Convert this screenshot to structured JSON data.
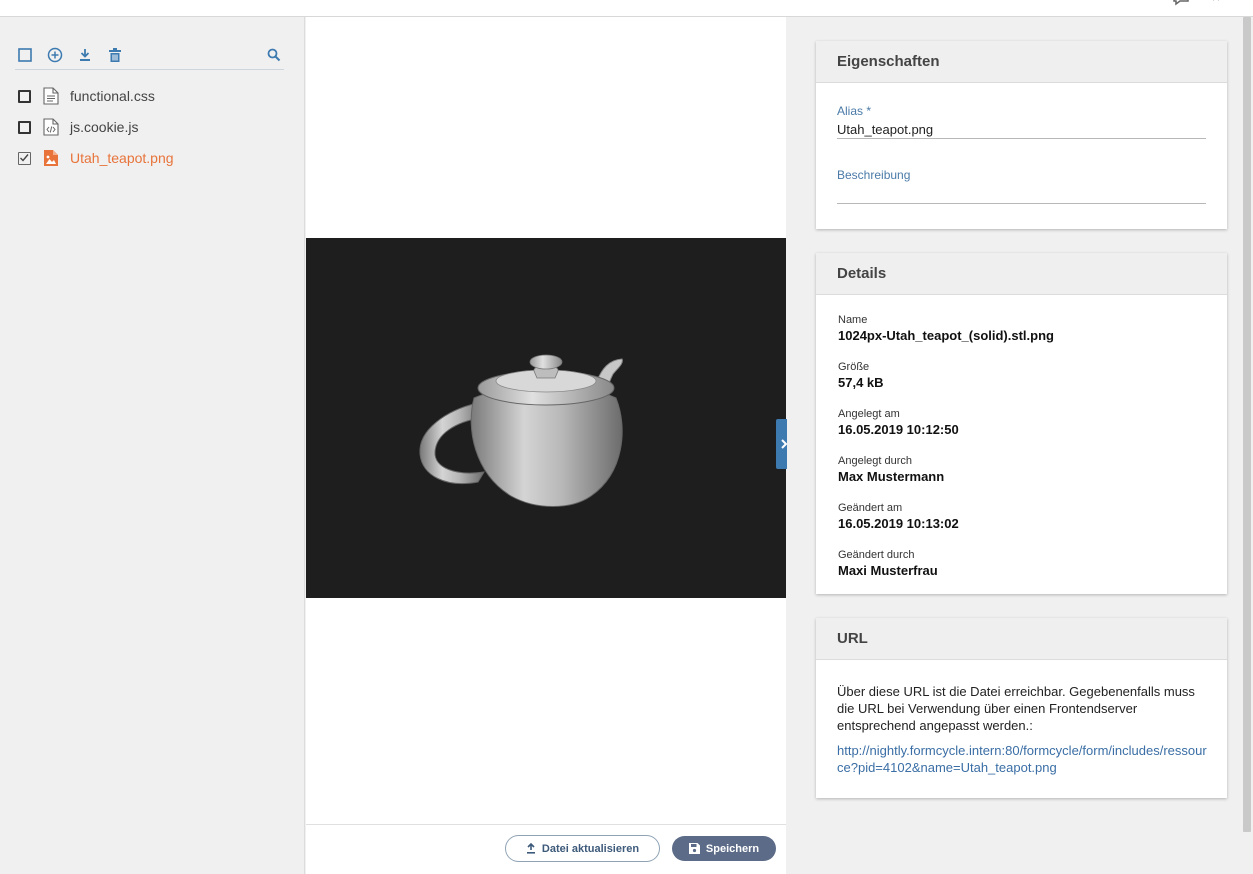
{
  "sidebar": {
    "files": [
      {
        "name": "functional.css",
        "icon": "file-text-icon",
        "checked": false
      },
      {
        "name": "js.cookie.js",
        "icon": "file-code-icon",
        "checked": false
      },
      {
        "name": "Utah_teapot.png",
        "icon": "file-image-icon",
        "checked": true
      }
    ]
  },
  "preview": {
    "update_button": "Datei aktualisieren",
    "save_button": "Speichern"
  },
  "properties": {
    "title": "Eigenschaften",
    "alias_label": "Alias *",
    "alias_value": "Utah_teapot.png",
    "description_label": "Beschreibung",
    "description_value": ""
  },
  "details": {
    "title": "Details",
    "name_label": "Name",
    "name_value": "1024px-Utah_teapot_(solid).stl.png",
    "size_label": "Größe",
    "size_value": "57,4 kB",
    "created_label": "Angelegt am",
    "created_value": "16.05.2019 10:12:50",
    "created_by_label": "Angelegt durch",
    "created_by_value": "Max Mustermann",
    "modified_label": "Geändert am",
    "modified_value": "16.05.2019 10:13:02",
    "modified_by_label": "Geändert durch",
    "modified_by_value": "Maxi Musterfrau"
  },
  "url": {
    "title": "URL",
    "text": "Über diese URL ist die Datei erreichbar. Gegebenenfalls muss die URL bei Verwendung über einen Frontendserver entsprechend angepasst werden.:",
    "link": "http://nightly.formcycle.intern:80/formcycle/form/includes/ressource?pid=4102&name=Utah_teapot.png"
  },
  "colors": {
    "accent": "#3d7ab0",
    "active_file": "#e8743b",
    "save_button": "#5c6b87"
  }
}
